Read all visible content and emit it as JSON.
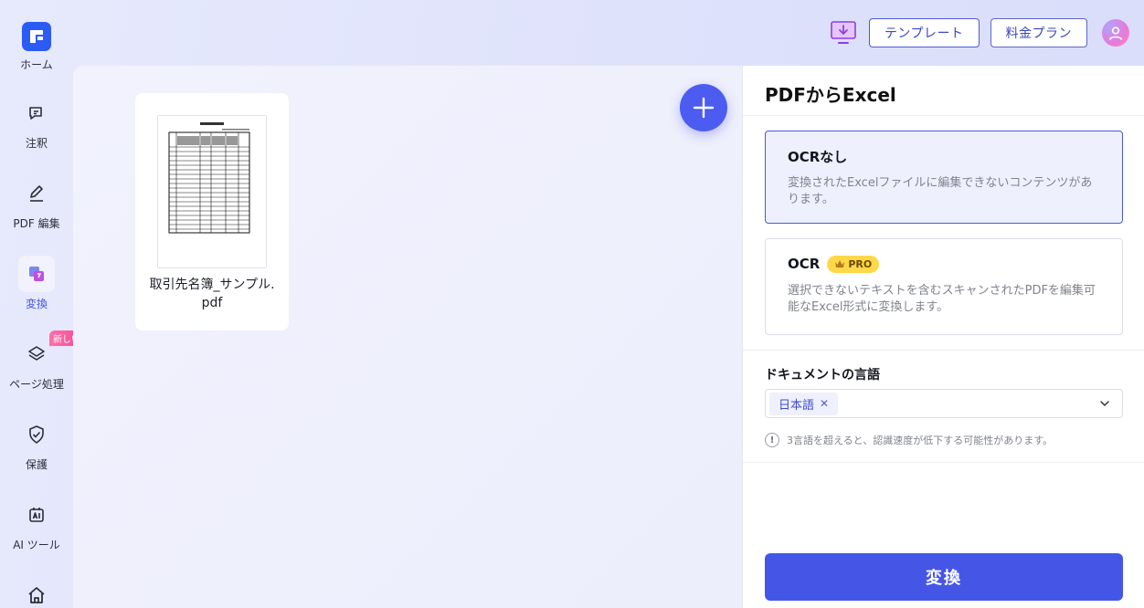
{
  "topbar": {
    "template_label": "テンプレート",
    "pricing_label": "料金プラン"
  },
  "sidebar": {
    "home_label": "ホーム",
    "items": [
      {
        "label": "注釈"
      },
      {
        "label": "PDF 編集"
      },
      {
        "label": "変換"
      },
      {
        "label": "ページ処理",
        "badge": "新しい"
      },
      {
        "label": "保護"
      },
      {
        "label": "AI ツール"
      }
    ]
  },
  "file": {
    "name": "取引先名簿_サンプル.pdf"
  },
  "panel": {
    "title": "PDFからExcel",
    "options": [
      {
        "title": "OCRなし",
        "desc": "変換されたExcelファイルに編集できないコンテンツがあります。",
        "selected": true
      },
      {
        "title": "OCR",
        "badge": "PRO",
        "desc": "選択できないテキストを含むスキャンされたPDFを編集可能なExcel形式に変換します。",
        "selected": false
      }
    ],
    "language_label": "ドキュメントの言語",
    "language_chip": "日本語",
    "hint": "3言語を超えると、認識速度が低下する可能性があります。",
    "convert_label": "変換"
  },
  "colors": {
    "accent": "#4556e6",
    "pro_badge": "#ffd84a",
    "new_badge": "#f24b93"
  },
  "icons": [
    "download-icon",
    "avatar-icon",
    "logo-icon",
    "annotate-icon",
    "edit-icon",
    "convert-icon",
    "layers-icon",
    "shield-icon",
    "ai-tool-icon",
    "house-icon",
    "plus-icon",
    "crown-icon",
    "chevron-down-icon",
    "info-icon",
    "close-icon"
  ]
}
